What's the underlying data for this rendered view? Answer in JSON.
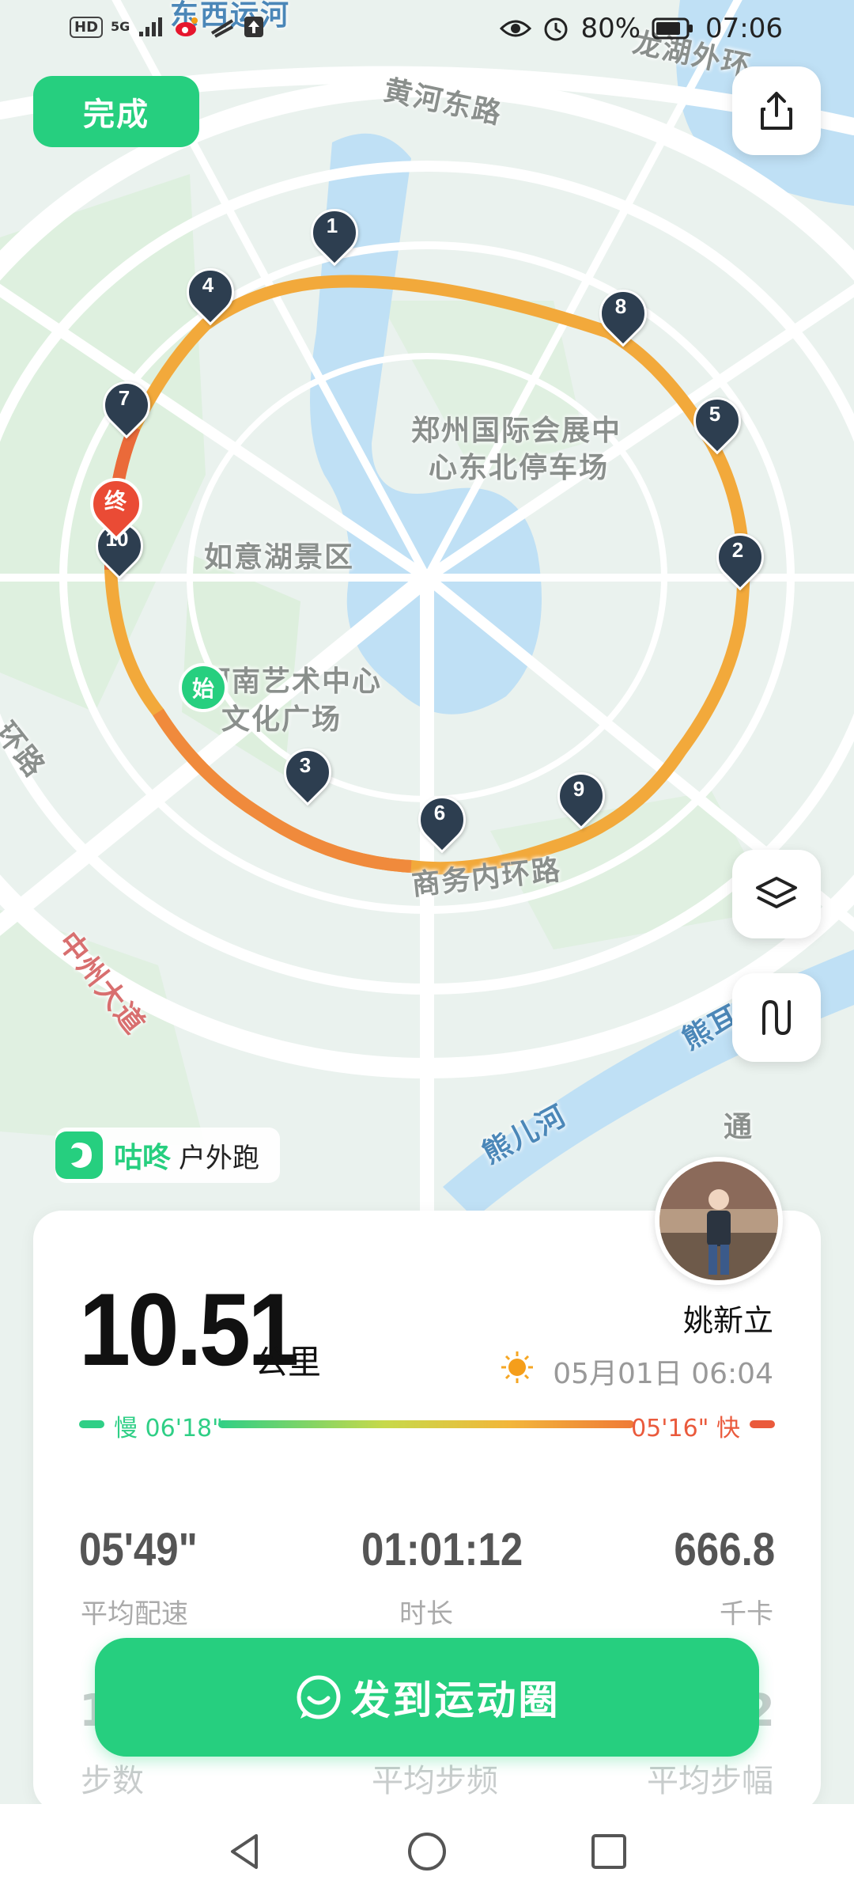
{
  "status_bar": {
    "left_badges": [
      "HD",
      "5G"
    ],
    "battery": "80%",
    "time": "07:06"
  },
  "header": {
    "done_label": "完成"
  },
  "map": {
    "labels": {
      "l1": "东西运河",
      "l2": "黄河东路",
      "l3": "龙湖外环",
      "l4": "郑州国际会展中",
      "l5": "心东北停车场",
      "l6": "如意湖景区",
      "l7": "河南艺术中心",
      "l8": "文化广场",
      "l9": "商务内环路",
      "l10": "中州大道",
      "l11": "熊儿河",
      "l12": "熊耳",
      "l13": "通",
      "l14": "环路"
    },
    "start_label": "始",
    "end_label": "终",
    "km_markers": [
      "1",
      "2",
      "3",
      "4",
      "5",
      "6",
      "7",
      "8",
      "9",
      "10"
    ]
  },
  "brand": {
    "name": "咕咚",
    "activity": "户外跑"
  },
  "summary": {
    "distance": "10.51",
    "distance_unit": "公里",
    "user_name": "姚新立",
    "datetime": "05月01日 06:04",
    "pace_slow": "慢 06'18\"",
    "pace_fast": "05'16\" 快",
    "stats": [
      {
        "value": "05'49\"",
        "label": "平均配速"
      },
      {
        "value": "01:01:12",
        "label": "时长"
      },
      {
        "value": "666.8",
        "label": "千卡"
      }
    ],
    "stats_row2": [
      {
        "value": "1",
        "label": "步数"
      },
      {
        "value": "",
        "label": "平均步频"
      },
      {
        "value": "2",
        "label": "平均步幅"
      }
    ]
  },
  "share_button": {
    "label": "发到运动圈"
  },
  "colors": {
    "accent": "#26cf7f",
    "route": "#f2a93b",
    "marker": "#2d3e50",
    "end": "#ea4b35"
  }
}
